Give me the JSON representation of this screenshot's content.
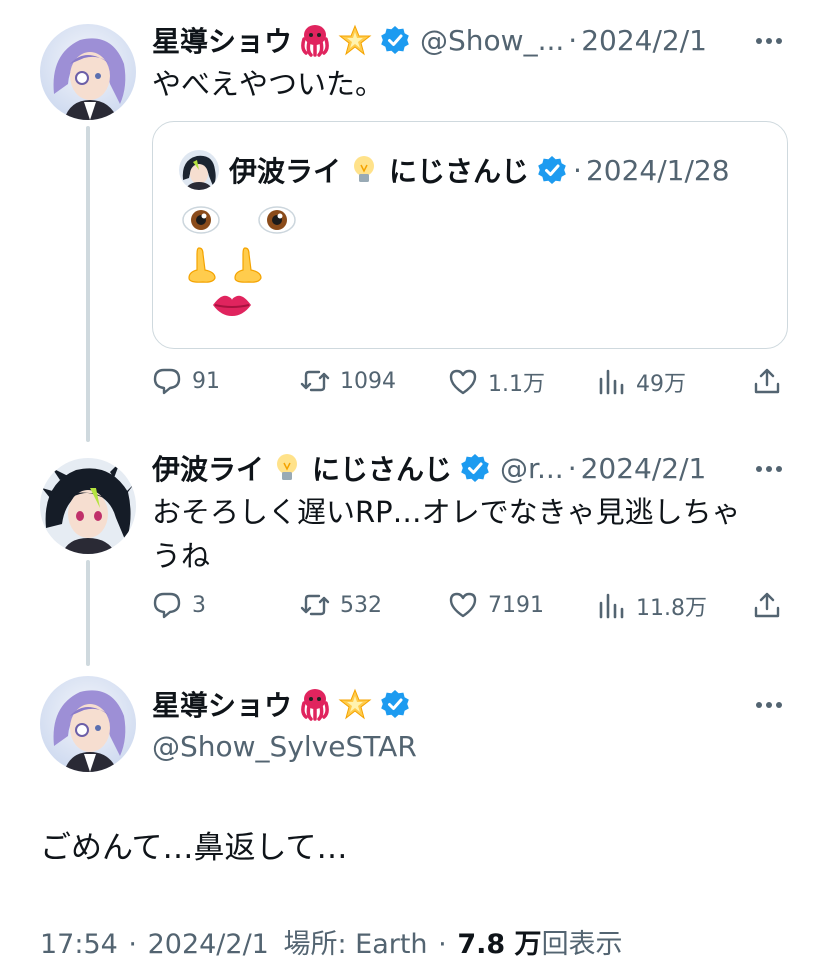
{
  "tweet1": {
    "display_name": "星導ショウ",
    "handle": "@Show_...",
    "sep": "·",
    "date": "2024/2/1",
    "text": "やべえやついた。",
    "quote": {
      "display_name": "伊波ライ",
      "affiliation": "にじさんじ",
      "sep": "·",
      "date": "2024/1/28",
      "face_emojis": [
        "eye-emoji",
        "eye-emoji",
        "nose-emoji",
        "nose-emoji",
        "lips-emoji"
      ]
    },
    "stats": {
      "replies": "91",
      "reposts": "1094",
      "likes": "1.1万",
      "views": "49万"
    }
  },
  "tweet2": {
    "display_name": "伊波ライ",
    "affiliation": "にじさんじ",
    "handle": "@r...",
    "sep": "·",
    "date": "2024/2/1",
    "text_line1": "おそろしく遅いRP…オレでなきゃ見逃しちゃ",
    "text_line2": "うね",
    "stats": {
      "replies": "3",
      "reposts": "532",
      "likes": "7191",
      "views": "11.8万"
    }
  },
  "main_tweet": {
    "display_name": "星導ショウ",
    "handle": "@Show_SylveSTAR",
    "text": "ごめんて…鼻返して…",
    "time": "17:54",
    "sep1": "·",
    "date": "2024/2/1",
    "location": "場所: Earth",
    "sep2": "·",
    "views_count": "7.8 万",
    "views_label": "回表示"
  },
  "colors": {
    "text": "#0f1419",
    "muted": "#536471",
    "verified": "#1d9bf0",
    "thread_line": "#cfd9de",
    "border": "#cfd9de"
  }
}
